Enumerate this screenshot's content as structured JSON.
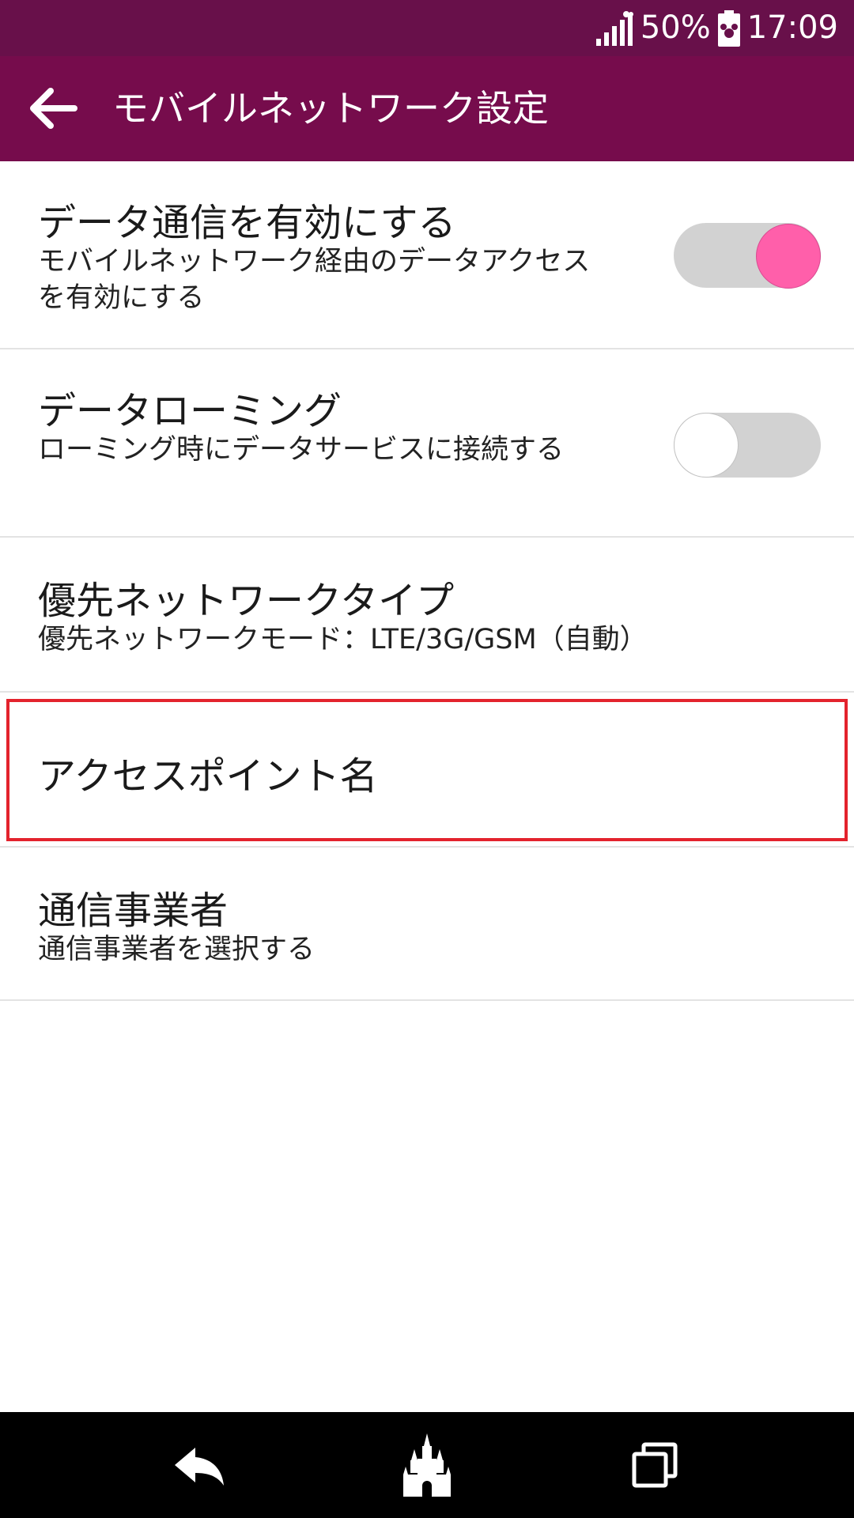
{
  "status_bar": {
    "signal_icon": "signal-bars-icon",
    "battery_percent": "50%",
    "battery_icon": "battery-mickey-icon",
    "time": "17:09"
  },
  "app_bar": {
    "back_icon": "arrow-back-icon",
    "title": "モバイルネットワーク設定",
    "background_color": "#760c4c",
    "status_bar_color": "#68104a"
  },
  "preferences": [
    {
      "title": "データ通信を有効にする",
      "summary": "モバイルネットワーク経由のデータアクセスを有効にする",
      "toggle": true
    },
    {
      "title": "データローミング",
      "summary": "ローミング時にデータサービスに接続する",
      "toggle": false
    },
    {
      "title": "優先ネットワークタイプ",
      "summary": "優先ネットワークモード：LTE/3G/GSM（自動）"
    },
    {
      "title": "アクセスポイント名",
      "highlighted": true
    },
    {
      "title": "通信事業者",
      "summary": "通信事業者を選択する"
    }
  ],
  "toggle_colors": {
    "on_thumb": "#ff5faa",
    "track": "#d2d2d2",
    "off_thumb": "#ffffff"
  },
  "highlight_color": "#e3232d",
  "nav_bar": {
    "back_icon": "nav-back-icon",
    "home_icon": "castle-home-icon",
    "recents_icon": "recent-apps-icon"
  }
}
